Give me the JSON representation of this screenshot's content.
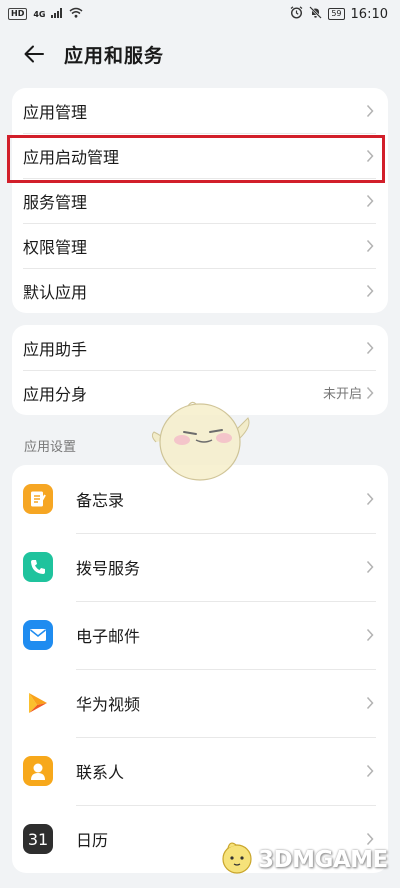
{
  "status_bar": {
    "hd": "HD",
    "network": "4G",
    "battery": "59",
    "time": "16:10"
  },
  "header": {
    "title": "应用和服务"
  },
  "group1": [
    {
      "label": "应用管理"
    },
    {
      "label": "应用启动管理"
    },
    {
      "label": "服务管理"
    },
    {
      "label": "权限管理"
    },
    {
      "label": "默认应用"
    }
  ],
  "group2": [
    {
      "label": "应用助手",
      "value": ""
    },
    {
      "label": "应用分身",
      "value": "未开启"
    }
  ],
  "section_title": "应用设置",
  "apps": [
    {
      "label": "备忘录",
      "icon": "notepad-icon",
      "color": "#f6a623"
    },
    {
      "label": "拨号服务",
      "icon": "phone-icon",
      "color": "#1fc39d"
    },
    {
      "label": "电子邮件",
      "icon": "email-icon",
      "color": "#1f8cf0"
    },
    {
      "label": "华为视频",
      "icon": "video-icon",
      "color": "#f47b20"
    },
    {
      "label": "联系人",
      "icon": "contact-icon",
      "color": "#f7a81b"
    },
    {
      "label": "日历",
      "icon": "calendar-icon",
      "color": "#2e2e2e",
      "glyph": "31"
    }
  ],
  "watermark": {
    "text": "3DMGAME"
  }
}
